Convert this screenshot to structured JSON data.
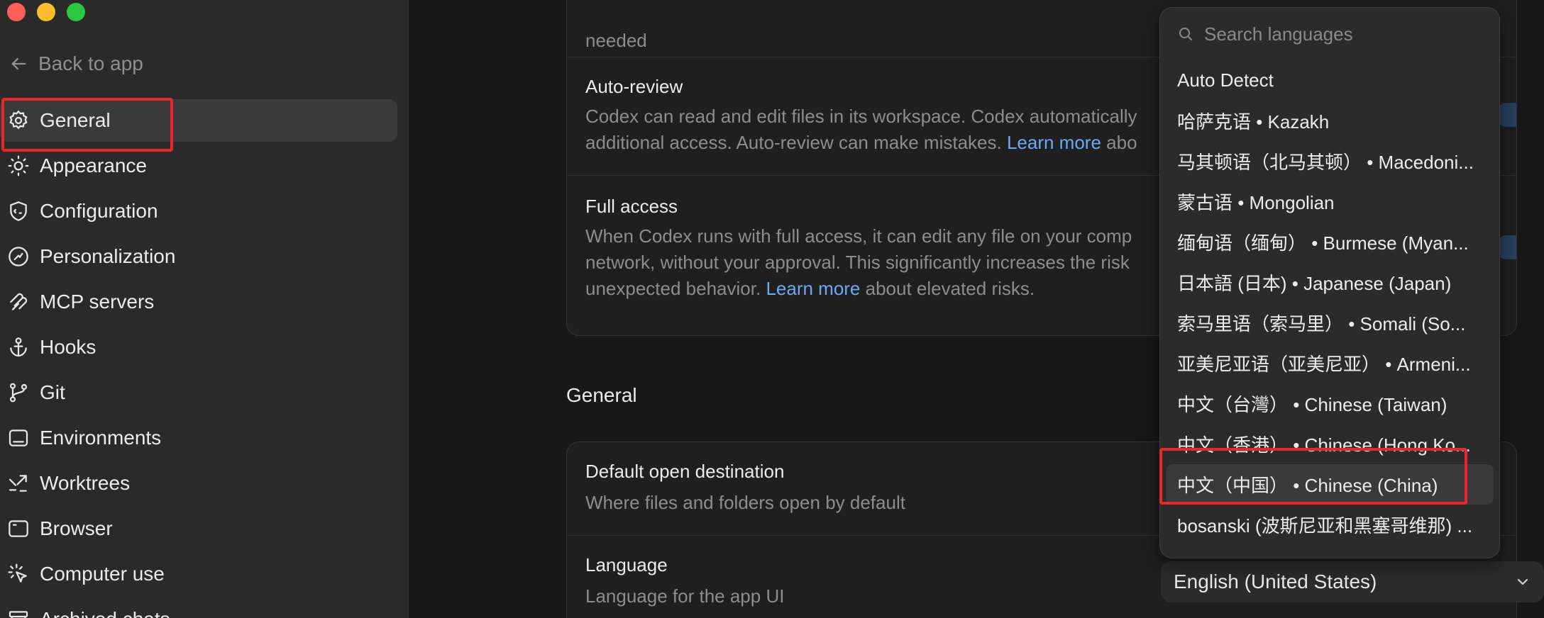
{
  "window": {
    "traffic_lights": [
      "close",
      "minimize",
      "zoom"
    ]
  },
  "sidebar": {
    "back_label": "Back to app",
    "items": [
      {
        "label": "General",
        "icon": "gear-icon"
      },
      {
        "label": "Appearance",
        "icon": "sun-icon"
      },
      {
        "label": "Configuration",
        "icon": "shield-code-icon"
      },
      {
        "label": "Personalization",
        "icon": "personalization-icon"
      },
      {
        "label": "MCP servers",
        "icon": "mcp-icon"
      },
      {
        "label": "Hooks",
        "icon": "anchor-icon"
      },
      {
        "label": "Git",
        "icon": "git-branch-icon"
      },
      {
        "label": "Environments",
        "icon": "environments-icon"
      },
      {
        "label": "Worktrees",
        "icon": "worktrees-icon"
      },
      {
        "label": "Browser",
        "icon": "browser-icon"
      },
      {
        "label": "Computer use",
        "icon": "cursor-click-icon"
      },
      {
        "label": "Archived chats",
        "icon": "archive-icon"
      }
    ]
  },
  "permissions": {
    "top_fragment": "needed",
    "auto_review": {
      "title": "Auto-review",
      "desc_line1": "Codex can read and edit files in its workspace. Codex automatically",
      "desc_line2_before": "additional access. Auto-review can make mistakes.",
      "link": "Learn more",
      "desc_line2_after": "abo"
    },
    "full_access": {
      "title": "Full access",
      "desc_line1": "When Codex runs with full access, it can edit any file on your comp",
      "desc_line2": "network, without your approval. This significantly increases the risk",
      "desc_line3_before": "unexpected behavior.",
      "link": "Learn more",
      "desc_line3_after": "about elevated risks."
    }
  },
  "general": {
    "section_title": "General",
    "default_open": {
      "title": "Default open destination",
      "desc": "Where files and folders open by default"
    },
    "language": {
      "title": "Language",
      "desc": "Language for the app UI",
      "selected": "English (United States)"
    }
  },
  "dropdown": {
    "search_placeholder": "Search languages",
    "items": [
      "Auto Detect",
      "哈萨克语 • Kazakh",
      "马其顿语（北马其顿） • Macedoni...",
      "蒙古语 • Mongolian",
      "缅甸语（缅甸） • Burmese (Myan...",
      "日本語 (日本) • Japanese (Japan)",
      "索马里语（索马里） • Somali (So...",
      "亚美尼亚语（亚美尼亚） • Armeni...",
      "中文（台灣） • Chinese (Taiwan)",
      "中文（香港） • Chinese (Hong Ko...",
      "中文（中国） • Chinese (China)",
      "bosanski (波斯尼亚和黑塞哥维那) ..."
    ],
    "selected_index": 10
  },
  "colors": {
    "accent_link": "#6aa9f5",
    "highlight_box": "#e8272c"
  }
}
